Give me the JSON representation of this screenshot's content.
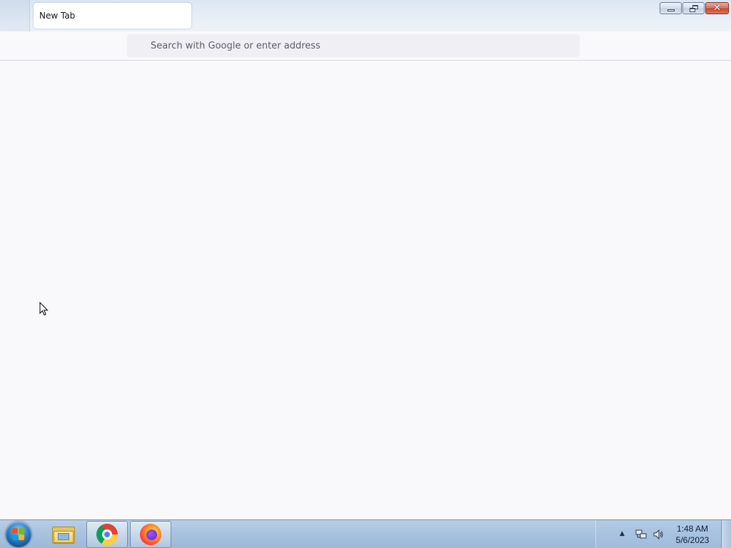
{
  "browser": {
    "tabs": [
      {
        "title": "New Tab",
        "active": true
      }
    ],
    "url_placeholder": "Search with Google or enter address"
  },
  "window_controls": {
    "minimize_icon": "minimize-icon",
    "restore_icon": "restore-icon",
    "close_icon": "close-icon"
  },
  "taskbar": {
    "pinned": [
      {
        "name": "Windows Explorer",
        "icon": "folder-icon",
        "active": false
      },
      {
        "name": "Google Chrome",
        "icon": "chrome-icon",
        "active": true
      },
      {
        "name": "Mozilla Firefox",
        "icon": "firefox-icon",
        "active": true
      }
    ],
    "tray": {
      "time": "1:48 AM",
      "date": "5/6/2023"
    }
  },
  "colors": {
    "page_bg": "#f9f9fb",
    "urlbar_bg": "#f0f0f4",
    "taskbar": "#a9c3df",
    "close_button": "#c7452b"
  }
}
